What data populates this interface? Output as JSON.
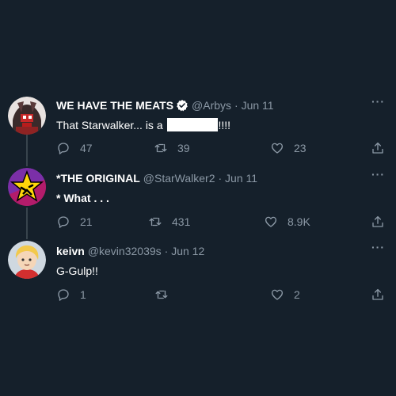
{
  "tweets": [
    {
      "display_name": "WE HAVE THE MEATS",
      "handle": "@Arbys",
      "date": "· Jun 11",
      "verified": true,
      "text_before": "That Starwalker... is a ",
      "text_after": "!!!!",
      "replies": "47",
      "retweets": "39",
      "likes": "23"
    },
    {
      "display_name": "*THE ORIGINAL",
      "handle": "@StarWalker2",
      "date": "· Jun 11",
      "verified": false,
      "text": "* What . . .",
      "replies": "21",
      "retweets": "431",
      "likes": "8.9K"
    },
    {
      "display_name": "keivn",
      "handle": "@kevin32039s",
      "date": "· Jun 12",
      "verified": false,
      "text": "G-Gulp!!",
      "replies": "1",
      "retweets": "",
      "likes": "2"
    }
  ],
  "more_glyph": "···",
  "icons": [
    "reply-icon",
    "retweet-icon",
    "like-icon",
    "share-icon",
    "verified-icon",
    "more-icon"
  ]
}
